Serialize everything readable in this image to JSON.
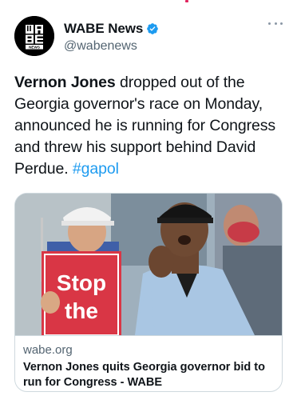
{
  "account": {
    "display_name": "WABE News",
    "handle": "@wabenews",
    "verified": true,
    "avatar_logo_text": "WABE NEWS"
  },
  "tweet": {
    "bold_lead": "Vernon Jones",
    "body": " dropped out of the Georgia governor's race on Monday, announced he is running for Congress and threw his support behind David Perdue. ",
    "hashtag": "#gapol"
  },
  "card": {
    "domain": "wabe.org",
    "title": "Vernon Jones quits Georgia governor bid to run for Congress - WABE",
    "image_sign_line1": "Stop",
    "image_sign_line2": "the"
  },
  "icons": {
    "verified": "verified-badge-icon",
    "more": "more-options-icon"
  },
  "colors": {
    "link": "#1d9bf0",
    "text": "#0f1419",
    "secondary": "#536471",
    "border": "#cfd9de",
    "sign_red": "#d93645"
  }
}
